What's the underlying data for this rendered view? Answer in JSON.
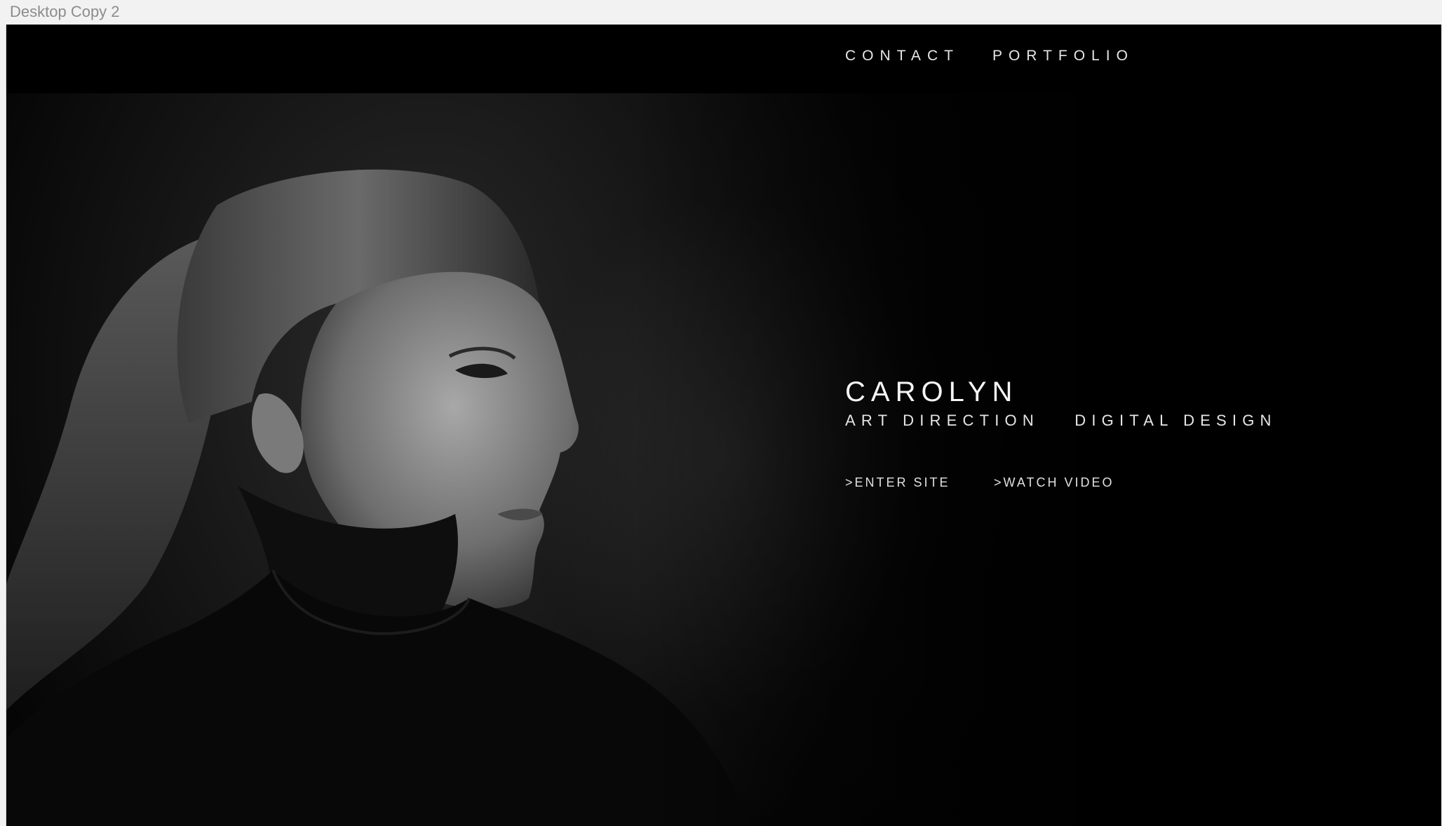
{
  "window": {
    "title": "Desktop Copy 2"
  },
  "nav": {
    "items": [
      {
        "label": "CONTACT"
      },
      {
        "label": "PORTFOLIO"
      }
    ]
  },
  "hero": {
    "name": "CAROLYN",
    "tags": [
      "ART DIRECTION",
      "DIGITAL DESIGN"
    ],
    "links": [
      {
        "label": ">ENTER SITE"
      },
      {
        "label": ">WATCH VIDEO"
      }
    ]
  },
  "colors": {
    "background": "#000000",
    "text": "#FFFFFF",
    "canvas": "#F2F2F2",
    "window_title": "#8C8C8C"
  }
}
